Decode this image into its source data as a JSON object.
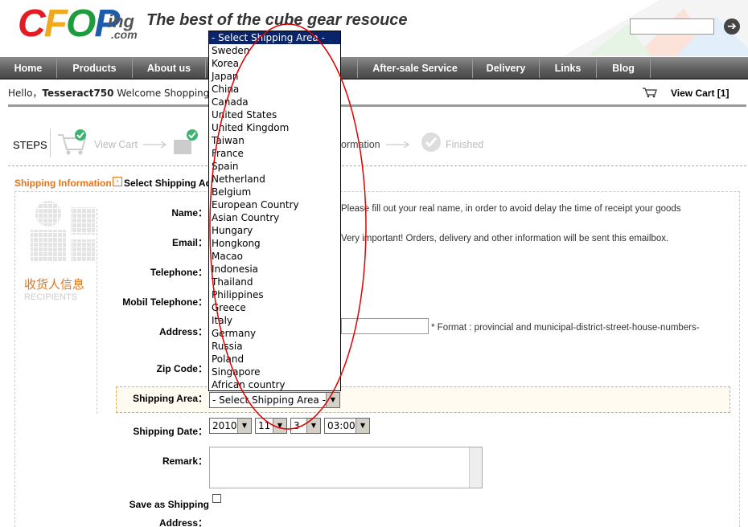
{
  "header": {
    "logo_letters": [
      "C",
      "F",
      "O",
      "P"
    ],
    "logo_ing": "ing",
    "logo_com": ".com",
    "slogan": "The best of the cube gear resouce",
    "search_arrow": "➔"
  },
  "nav": [
    {
      "label": "Home"
    },
    {
      "label": "Products"
    },
    {
      "label": "About us"
    },
    {
      "label": "After-sale Service"
    },
    {
      "label": "Delivery"
    },
    {
      "label": "Links"
    },
    {
      "label": "Blog"
    }
  ],
  "userbar": {
    "hello": "Hello，",
    "username": "Tesseract750",
    "welcome": "Welcome Shopping！|",
    "view_cart": "View Cart [1]"
  },
  "steps": {
    "label": "STEPS",
    "items": [
      "View Cart",
      "ormation",
      "Finished"
    ]
  },
  "section": {
    "title": "Shipping Information",
    "subtitle": "Select Shipping Ad"
  },
  "recipients": {
    "cn": "收货人信息",
    "en": "RECIPIENTS"
  },
  "form": {
    "name_label": "Name：",
    "name_hint": "Please fill out your real name, in order to avoid delay the time of receipt your goods",
    "email_label": "Email：",
    "email_hint": "Very important! Orders, delivery and other information will be sent this emailbox.",
    "telephone_label": "Telephone：",
    "mobile_label": "Mobil Telephone：",
    "address_label": "Address：",
    "address_hint": "* Format : provincial and municipal-district-street-house-numbers-",
    "zip_label": "Zip Code：",
    "area_label": "Shipping Area：",
    "area_value": "- Select Shipping Area -",
    "date_label": "Shipping Date：",
    "date_year": "2010",
    "date_month": "11",
    "date_day": "3",
    "date_time": "03:00",
    "remark_label": "Remark：",
    "save_label_1": "Save as Shipping",
    "save_label_2": "Address："
  },
  "dropdown": {
    "options": [
      "- Select Shipping Area -",
      "Sweden",
      "Korea",
      "Japan",
      "China",
      "Canada",
      "United States",
      "United Kingdom",
      "Taiwan",
      "France",
      "Spain",
      "Netherland",
      "Belgium",
      "European Country",
      "Asian Country",
      "Hungary",
      "Hongkong",
      "Macao",
      "Indonesia",
      "Thailand",
      "Philippines",
      "Greece",
      "Italy",
      "Germany",
      "Russia",
      "Poland",
      "Singapore",
      "African country"
    ],
    "selected_index": 0
  },
  "colors": {
    "accent": "#e8741a",
    "nav": "#5d5d5d",
    "highlight": "#0a246a",
    "annotation": "#e00000"
  },
  "icons": [
    "cart-icon",
    "check-icon",
    "arrow-icon",
    "search-arrow-icon"
  ]
}
